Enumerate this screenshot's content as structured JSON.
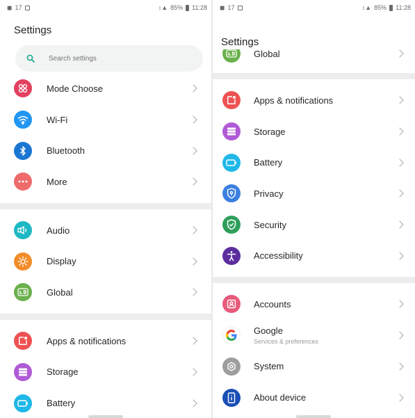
{
  "status_left": {
    "time_left": "17",
    "right_text": "85%",
    "clock": "11:28"
  },
  "status_right": {
    "time_left": "17",
    "right_text": "85%",
    "clock": "11:28"
  },
  "left_screen": {
    "title": "Settings",
    "search_placeholder": "Search settings",
    "groups": [
      [
        {
          "label": "Mode Choose",
          "icon": "mode-choose-icon",
          "color": "#e4405f"
        },
        {
          "label": "Wi-Fi",
          "icon": "wifi-icon",
          "color": "#2196f3"
        },
        {
          "label": "Bluetooth",
          "icon": "bluetooth-icon",
          "color": "#1976d2"
        },
        {
          "label": "More",
          "icon": "more-icon",
          "color": "#ef6b6b"
        }
      ],
      [
        {
          "label": "Audio",
          "icon": "audio-icon",
          "color": "#1eb8c4"
        },
        {
          "label": "Display",
          "icon": "display-icon",
          "color": "#f28c28"
        },
        {
          "label": "Global",
          "icon": "global-icon",
          "color": "#6ab04c"
        }
      ],
      [
        {
          "label": "Apps & notifications",
          "icon": "apps-icon",
          "color": "#ee5253"
        },
        {
          "label": "Storage",
          "icon": "storage-icon",
          "color": "#b05ad6"
        },
        {
          "label": "Battery",
          "icon": "battery-icon",
          "color": "#1fb8e8"
        }
      ]
    ]
  },
  "right_screen": {
    "title": "Settings",
    "partial_item": {
      "label": "Global",
      "icon": "global-icon",
      "color": "#6ab04c"
    },
    "groups": [
      [
        {
          "label": "Apps & notifications",
          "icon": "apps-icon",
          "color": "#ee5253"
        },
        {
          "label": "Storage",
          "icon": "storage-icon",
          "color": "#b05ad6"
        },
        {
          "label": "Battery",
          "icon": "battery-icon",
          "color": "#1fb8e8"
        },
        {
          "label": "Privacy",
          "icon": "privacy-icon",
          "color": "#3b7fe0"
        },
        {
          "label": "Security",
          "icon": "security-icon",
          "color": "#2e9e5b"
        },
        {
          "label": "Accessibility",
          "icon": "accessibility-icon",
          "color": "#5b2d9e"
        }
      ],
      [
        {
          "label": "Accounts",
          "icon": "accounts-icon",
          "color": "#e85a7a"
        },
        {
          "label": "Google",
          "sub": "Services & preferences",
          "icon": "google-icon",
          "color": "#ffffff"
        },
        {
          "label": "System",
          "icon": "system-icon",
          "color": "#9e9e9e"
        },
        {
          "label": "About device",
          "icon": "about-device-icon",
          "color": "#1a4fb5"
        }
      ]
    ]
  }
}
